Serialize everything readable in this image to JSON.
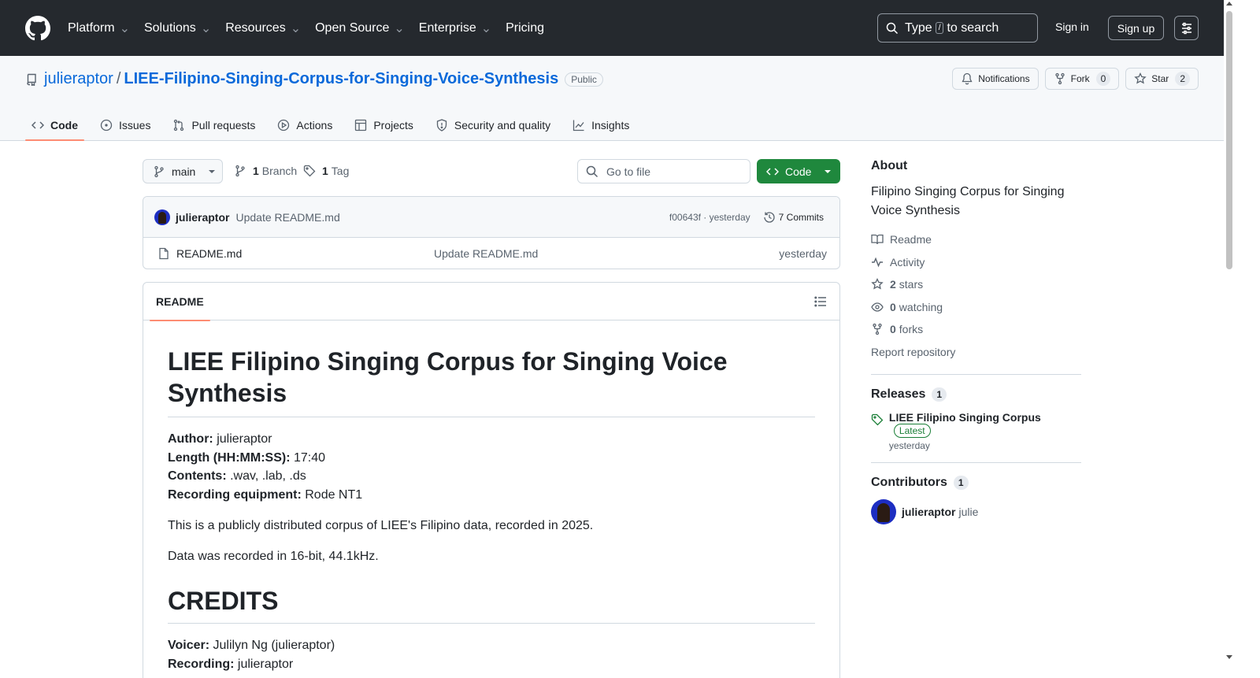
{
  "header": {
    "nav": [
      {
        "label": "Platform",
        "has_menu": true
      },
      {
        "label": "Solutions",
        "has_menu": true
      },
      {
        "label": "Resources",
        "has_menu": true
      },
      {
        "label": "Open Source",
        "has_menu": true
      },
      {
        "label": "Enterprise",
        "has_menu": true
      },
      {
        "label": "Pricing",
        "has_menu": false
      }
    ],
    "search": {
      "prefix": "Type",
      "key": "/",
      "suffix": "to search"
    },
    "sign_in": "Sign in",
    "sign_up": "Sign up"
  },
  "repo": {
    "owner": "julieraptor",
    "separator": "/",
    "name": "LIEE-Filipino-Singing-Corpus-for-Singing-Voice-Synthesis",
    "visibility": "Public",
    "notifications_label": "Notifications",
    "fork_label": "Fork",
    "fork_count": "0",
    "star_label": "Star",
    "star_count": "2"
  },
  "tabs": [
    {
      "label": "Code",
      "icon": "code-icon",
      "active": true
    },
    {
      "label": "Issues",
      "icon": "issue-icon",
      "active": false
    },
    {
      "label": "Pull requests",
      "icon": "pull-request-icon",
      "active": false
    },
    {
      "label": "Actions",
      "icon": "play-icon",
      "active": false
    },
    {
      "label": "Projects",
      "icon": "table-icon",
      "active": false
    },
    {
      "label": "Security and quality",
      "icon": "shield-icon",
      "active": false
    },
    {
      "label": "Insights",
      "icon": "graph-icon",
      "active": false
    }
  ],
  "branchbar": {
    "branch": "main",
    "branch_count": "1",
    "branch_label": "Branch",
    "tag_count": "1",
    "tag_label": "Tag",
    "go_to_file_placeholder": "Go to file",
    "code_label": "Code"
  },
  "latest_commit": {
    "user": "julieraptor",
    "message": "Update README.md",
    "hash_time": "f00643f · yesterday",
    "commits_label": "7 Commits"
  },
  "files": [
    {
      "name": "README.md",
      "message": "Update README.md",
      "date": "yesterday"
    }
  ],
  "readme": {
    "tab_label": "README",
    "title": "LIEE Filipino Singing Corpus for Singing Voice Synthesis",
    "fields": [
      {
        "key": "Author:",
        "value": "julieraptor"
      },
      {
        "key": "Length (HH:MM:SS):",
        "value": "17:40"
      },
      {
        "key": "Contents:",
        "value": ".wav, .lab, .ds"
      },
      {
        "key": "Recording equipment:",
        "value": "Rode NT1"
      }
    ],
    "para1": "This is a publicly distributed corpus of LIEE's Filipino data, recorded in 2025.",
    "para2": "Data was recorded in 16-bit, 44.1kHz.",
    "credits_title": "CREDITS",
    "credits": [
      {
        "key": "Voicer:",
        "value": "Julilyn Ng (julieraptor)"
      },
      {
        "key": "Recording:",
        "value": "julieraptor"
      }
    ]
  },
  "about": {
    "title": "About",
    "description": "Filipino Singing Corpus for Singing Voice Synthesis",
    "readme": "Readme",
    "activity": "Activity",
    "stars_count": "2",
    "stars_label": "stars",
    "watching_count": "0",
    "watching_label": "watching",
    "forks_count": "0",
    "forks_label": "forks",
    "report": "Report repository"
  },
  "releases": {
    "title": "Releases",
    "count": "1",
    "name": "LIEE Filipino Singing Corpus",
    "badge": "Latest",
    "date": "yesterday"
  },
  "contributors": {
    "title": "Contributors",
    "count": "1",
    "user": "julieraptor",
    "name": "julie"
  }
}
